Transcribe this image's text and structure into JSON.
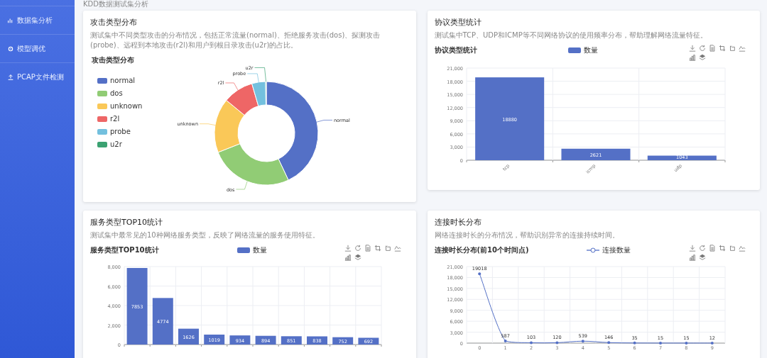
{
  "sidebar": {
    "items": [
      {
        "label": "数据集分析"
      },
      {
        "label": "模型调优"
      },
      {
        "label": "PCAP文件检测"
      }
    ]
  },
  "page_title": "KDD数据测试集分析",
  "cards": [
    {
      "title": "攻击类型分布",
      "description": "测试集中不同类型攻击的分布情况，包括正常流量(normal)、拒绝服务攻击(dos)、探测攻击(probe)、远程到本地攻击(r2l)和用户到根目录攻击(u2r)的占比。",
      "legend": [
        {
          "label": "normal",
          "color": "#5470c6"
        },
        {
          "label": "dos",
          "color": "#91cc75"
        },
        {
          "label": "unknown",
          "color": "#fac858"
        },
        {
          "label": "r2l",
          "color": "#ee6666"
        },
        {
          "label": "probe",
          "color": "#73c0de"
        },
        {
          "label": "u2r",
          "color": "#3ba272"
        }
      ],
      "chart_data": {
        "type": "donut",
        "title": "攻击类型分布",
        "categories": [
          "normal",
          "dos",
          "unknown",
          "r2l",
          "probe",
          "u2r"
        ],
        "values": [
          43,
          26,
          17,
          9.5,
          4.3,
          0.2
        ]
      }
    },
    {
      "title": "协议类型统计",
      "description": "测试集中TCP、UDP和ICMP等不同网络协议的使用频率分布，帮助理解网络流量特征。",
      "chart_data": {
        "type": "bar",
        "title": "协议类型统计",
        "categories": [
          "tcp",
          "icmp",
          "udp"
        ],
        "series": [
          {
            "name": "数量",
            "color": "#5470c6",
            "values": [
              18880,
              2621,
              1043
            ]
          }
        ],
        "ylim": [
          0,
          21000
        ],
        "grid": true,
        "yticks": [
          {
            "value": 0,
            "label": "0"
          },
          {
            "value": 3000,
            "label": "3,000"
          },
          {
            "value": 6000,
            "label": "6,000"
          },
          {
            "value": 9000,
            "label": "9,000"
          },
          {
            "value": 12000,
            "label": "12,000"
          },
          {
            "value": 15000,
            "label": "15,000"
          },
          {
            "value": 18000,
            "label": "18,000"
          },
          {
            "value": 21000,
            "label": "21,000"
          }
        ],
        "data_labels": true
      }
    },
    {
      "title": "服务类型TOP10统计",
      "description": "测试集中最常见的10种网络服务类型，反映了网络流量的服务使用特征。",
      "chart_data": {
        "type": "bar",
        "title": "服务类型TOP10统计",
        "series": [
          {
            "name": "数量",
            "color": "#5470c6",
            "values": [
              7853,
              4774,
              1626,
              1019,
              934,
              894,
              851,
              838,
              752,
              692
            ]
          }
        ],
        "ylim": [
          0,
          8000
        ],
        "grid": true,
        "yticks": [
          {
            "value": 0,
            "label": "0"
          },
          {
            "value": 2000,
            "label": "2,000"
          },
          {
            "value": 4000,
            "label": "4,000"
          },
          {
            "value": 6000,
            "label": "6,000"
          },
          {
            "value": 8000,
            "label": "8,000"
          }
        ],
        "data_labels": true
      }
    },
    {
      "title": "连接时长分布",
      "description": "网络连接时长的分布情况，帮助识别异常的连接持续时间。",
      "chart_data": {
        "type": "line",
        "title": "连接时长分布(前10个时间点)",
        "x": [
          "0",
          "1",
          "2",
          "3",
          "4",
          "5",
          "6",
          "7",
          "8",
          "9"
        ],
        "series": [
          {
            "name": "连接数量",
            "color": "#5470c6",
            "values": [
              19018,
              587,
              103,
              120,
              539,
              146,
              35,
              15,
              15,
              12
            ]
          }
        ],
        "ylim": [
          0,
          21000
        ],
        "grid": true,
        "yticks": [
          {
            "value": 0,
            "label": "0"
          },
          {
            "value": 3000,
            "label": "3,000"
          },
          {
            "value": 6000,
            "label": "6,000"
          },
          {
            "value": 9000,
            "label": "9,000"
          },
          {
            "value": 12000,
            "label": "12,000"
          },
          {
            "value": 15000,
            "label": "15,000"
          },
          {
            "value": 18000,
            "label": "18,000"
          },
          {
            "value": 21000,
            "label": "21,000"
          }
        ],
        "data_labels": true
      }
    }
  ]
}
